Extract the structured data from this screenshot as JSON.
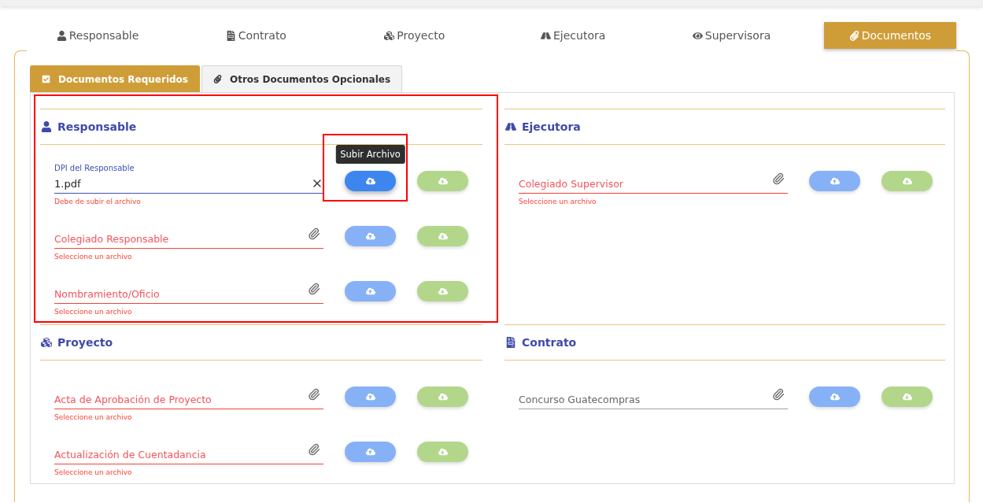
{
  "nav_tabs": [
    {
      "label": "Responsable",
      "selected": false
    },
    {
      "label": "Contrato",
      "selected": false
    },
    {
      "label": "Proyecto",
      "selected": false
    },
    {
      "label": "Ejecutora",
      "selected": false
    },
    {
      "label": "Supervisora",
      "selected": false
    },
    {
      "label": "Documentos",
      "selected": true
    }
  ],
  "sub_tabs": [
    {
      "label": "Documentos Requeridos",
      "selected": true
    },
    {
      "label": "Otros Documentos Opcionales",
      "selected": false
    }
  ],
  "sections": [
    {
      "title": "Responsable",
      "highlighted": true,
      "fields": [
        {
          "label": "DPI del Responsable",
          "value": "1.pdf",
          "hint": "Debe de subir el archivo",
          "error": true,
          "upload_enabled": true,
          "upload_highlighted": true,
          "tooltip": "Subir Archivo",
          "download_enabled": false
        },
        {
          "label": "Colegiado Responsable",
          "hint": "Seleccione un archivo",
          "error": true,
          "upload_enabled": false,
          "upload_highlighted": false,
          "download_enabled": false
        },
        {
          "label": "Nombramiento/Oficio",
          "hint": "Seleccione un archivo",
          "error": true,
          "upload_enabled": false,
          "upload_highlighted": false,
          "download_enabled": false
        }
      ]
    },
    {
      "title": "Ejecutora",
      "highlighted": false,
      "fields": [
        {
          "label": "Colegiado Supervisor",
          "hint": "Seleccione un archivo",
          "error": true,
          "upload_enabled": false,
          "upload_highlighted": false,
          "download_enabled": false
        }
      ]
    },
    {
      "title": "Proyecto",
      "highlighted": false,
      "fields": [
        {
          "label": "Acta de Aprobación de Proyecto",
          "hint": "Seleccione un archivo",
          "error": true,
          "upload_enabled": false,
          "upload_highlighted": false,
          "download_enabled": false
        },
        {
          "label": "Actualización de Cuentadancia",
          "hint": "Seleccione un archivo",
          "error": true,
          "upload_enabled": false,
          "upload_highlighted": false,
          "download_enabled": false
        }
      ]
    },
    {
      "title": "Contrato",
      "highlighted": false,
      "fields": [
        {
          "label": "Concurso Guatecompras",
          "error": false,
          "upload_enabled": false,
          "upload_highlighted": false,
          "download_enabled": false
        }
      ]
    }
  ]
}
